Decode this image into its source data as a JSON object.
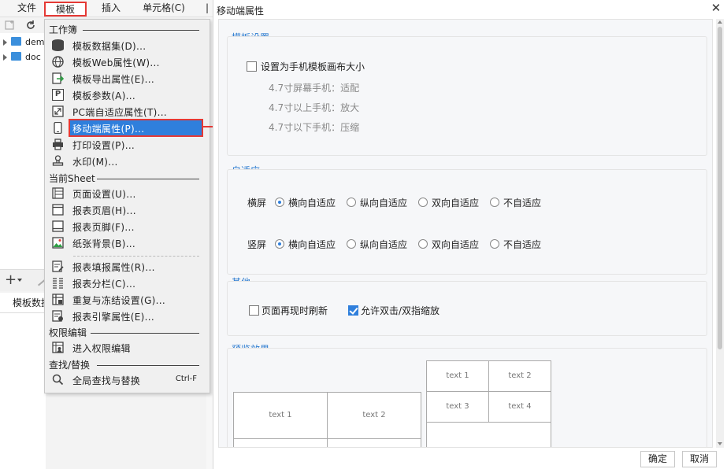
{
  "menubar": {
    "file": "文件",
    "template": "模板",
    "insert": "插入",
    "cell": "单元格(C)",
    "extra": "|"
  },
  "tree": [
    {
      "label": "dem"
    },
    {
      "label": "doc"
    }
  ],
  "lower_tab": "模板数据",
  "menu": {
    "sections": {
      "workbook": "工作簿",
      "sheet": "当前Sheet",
      "permission": "权限编辑",
      "find": "查找/替换"
    },
    "items": [
      {
        "label": "模板数据集(D)..."
      },
      {
        "label": "模板Web属性(W)..."
      },
      {
        "label": "模板导出属性(E)..."
      },
      {
        "label": "模板参数(A)..."
      },
      {
        "label": "PC端自适应属性(T)..."
      },
      {
        "label": "移动端属性(P)..."
      },
      {
        "label": "打印设置(P)..."
      },
      {
        "label": "水印(M)..."
      },
      {
        "label": "页面设置(U)..."
      },
      {
        "label": "报表页眉(H)..."
      },
      {
        "label": "报表页脚(F)..."
      },
      {
        "label": "纸张背景(B)..."
      },
      {
        "label": "报表填报属性(R)..."
      },
      {
        "label": "报表分栏(C)..."
      },
      {
        "label": "重复与冻结设置(G)..."
      },
      {
        "label": "报表引擎属性(E)..."
      },
      {
        "label": "进入权限编辑"
      },
      {
        "label": "全局查找与替换",
        "shortcut": "Ctrl-F"
      }
    ]
  },
  "dialog": {
    "title": "移动端属性",
    "template_settings": {
      "title": "模板设置",
      "checkbox_label": "设置为手机模板画布大小",
      "checked": false,
      "hints": [
        "4.7寸屏幕手机：适配",
        "4.7寸以上手机：放大",
        "4.7寸以下手机：压缩"
      ]
    },
    "adaptive": {
      "title": "自适应",
      "options": [
        "横向自适应",
        "纵向自适应",
        "双向自适应",
        "不自适应"
      ],
      "landscape": {
        "label": "横屏",
        "selected": "横向自适应"
      },
      "portrait": {
        "label": "竖屏",
        "selected": "横向自适应"
      }
    },
    "other": {
      "title": "其他",
      "refresh_label": "页面再现时刷新",
      "refresh_checked": false,
      "zoom_label": "允许双击/双指缩放",
      "zoom_checked": true
    },
    "preview": {
      "title": "预览效果",
      "cells": [
        "text 1",
        "text 2",
        "text 1",
        "text 2",
        "text 3",
        "text 4"
      ]
    },
    "ok": "确定",
    "cancel": "取消"
  },
  "colors": {
    "accent": "#2f7fdc",
    "highlight_border": "#e53935",
    "section_title": "#2b7bd0"
  }
}
